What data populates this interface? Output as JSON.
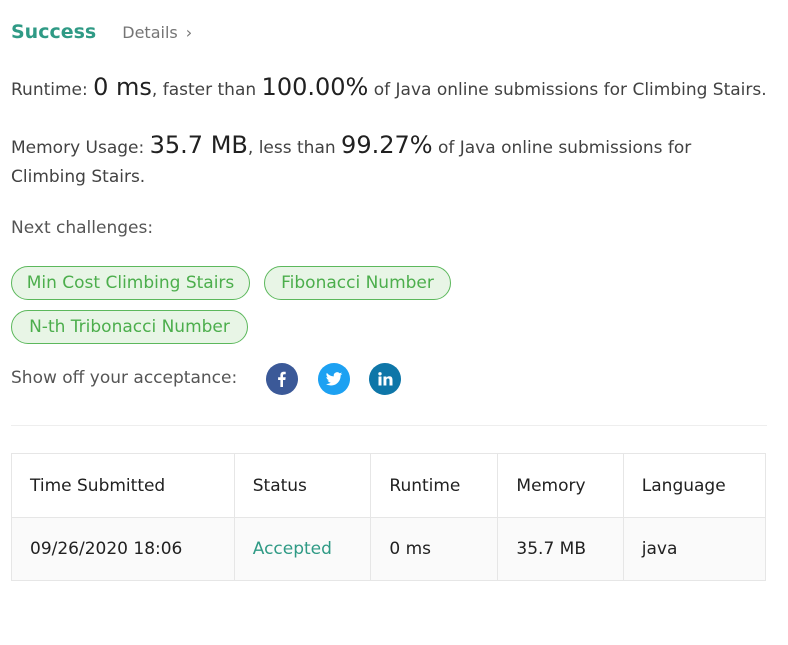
{
  "header": {
    "status": "Success",
    "details_label": "Details",
    "chevron": "›"
  },
  "runtime": {
    "prefix": "Runtime: ",
    "value": "0 ms",
    "middle": ", faster than ",
    "percent": "100.00%",
    "suffix": " of Java online submissions for Climbing Stairs."
  },
  "memory": {
    "prefix": "Memory Usage: ",
    "value": "35.7 MB",
    "middle": ", less than ",
    "percent": "99.27%",
    "suffix": " of Java online submissions for Climbing Stairs."
  },
  "next": {
    "label": "Next challenges:",
    "items": [
      "Min Cost Climbing Stairs",
      "Fibonacci Number",
      "N-th Tribonacci Number"
    ]
  },
  "share": {
    "label": "Show off your acceptance:",
    "icons": [
      "facebook-icon",
      "twitter-icon",
      "linkedin-icon"
    ]
  },
  "table": {
    "headers": [
      "Time Submitted",
      "Status",
      "Runtime",
      "Memory",
      "Language"
    ],
    "rows": [
      [
        "09/26/2020 18:06",
        "Accepted",
        "0 ms",
        "35.7 MB",
        "java"
      ]
    ]
  },
  "colors": {
    "accent": "#2f9a85",
    "tag_border": "#5cb85c",
    "tag_bg": "#e8f5e6",
    "facebook": "#3b5998",
    "twitter": "#1da1f2",
    "linkedin": "#0e76a8"
  }
}
